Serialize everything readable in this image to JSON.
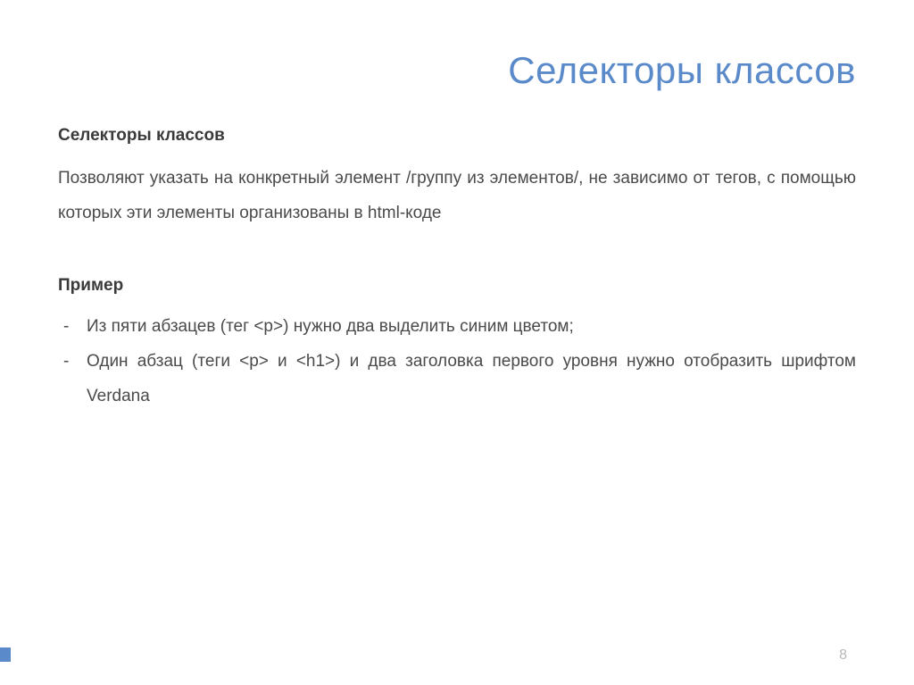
{
  "title": "Селекторы классов",
  "subtitle": "Селекторы классов",
  "description": "Позволяют указать на конкретный элемент /группу из элементов/, не зависимо от тегов, с помощью которых эти элементы организованы в html-коде",
  "exampleTitle": "Пример",
  "exampleItems": [
    "Из пяти абзацев (тег <p>) нужно два выделить синим цветом;",
    "Один абзац (теги <p> и <h1>) и два заголовка первого уровня нужно отобразить шрифтом Verdana"
  ],
  "pageNumber": "8"
}
